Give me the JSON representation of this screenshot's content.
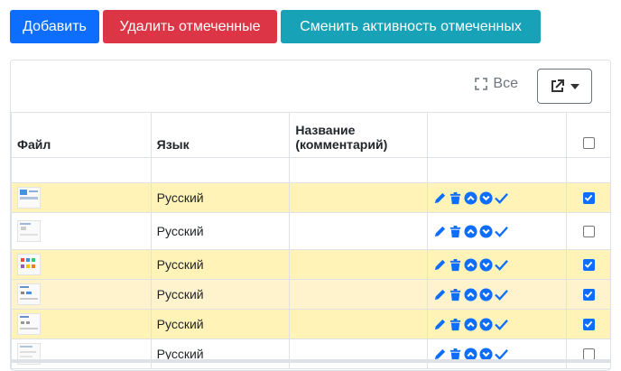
{
  "toolbar": {
    "add_label": "Добавить",
    "delete_label": "Удалить отмеченные",
    "toggle_label": "Сменить активность отмеченных"
  },
  "card": {
    "all_label": "Все"
  },
  "table": {
    "headers": {
      "file": "Файл",
      "language": "Язык",
      "name_line1": "Название",
      "name_line2": "(комментарий)"
    },
    "rows": [
      {
        "language": "Русский",
        "checked": true
      },
      {
        "language": "Русский",
        "checked": false
      },
      {
        "language": "Русский",
        "checked": true
      },
      {
        "language": "Русский",
        "checked": true
      },
      {
        "language": "Русский",
        "checked": true
      },
      {
        "language": "Русский",
        "checked": false
      }
    ]
  },
  "colors": {
    "primary": "#0d6efd",
    "danger": "#dc3545",
    "info": "#17a2b8",
    "row_highlight": "#fff3b8"
  },
  "icons": [
    "expand-icon",
    "export-icon",
    "caret-down-icon",
    "edit-icon",
    "trash-icon",
    "arrow-up-icon",
    "arrow-down-icon",
    "check-icon"
  ]
}
